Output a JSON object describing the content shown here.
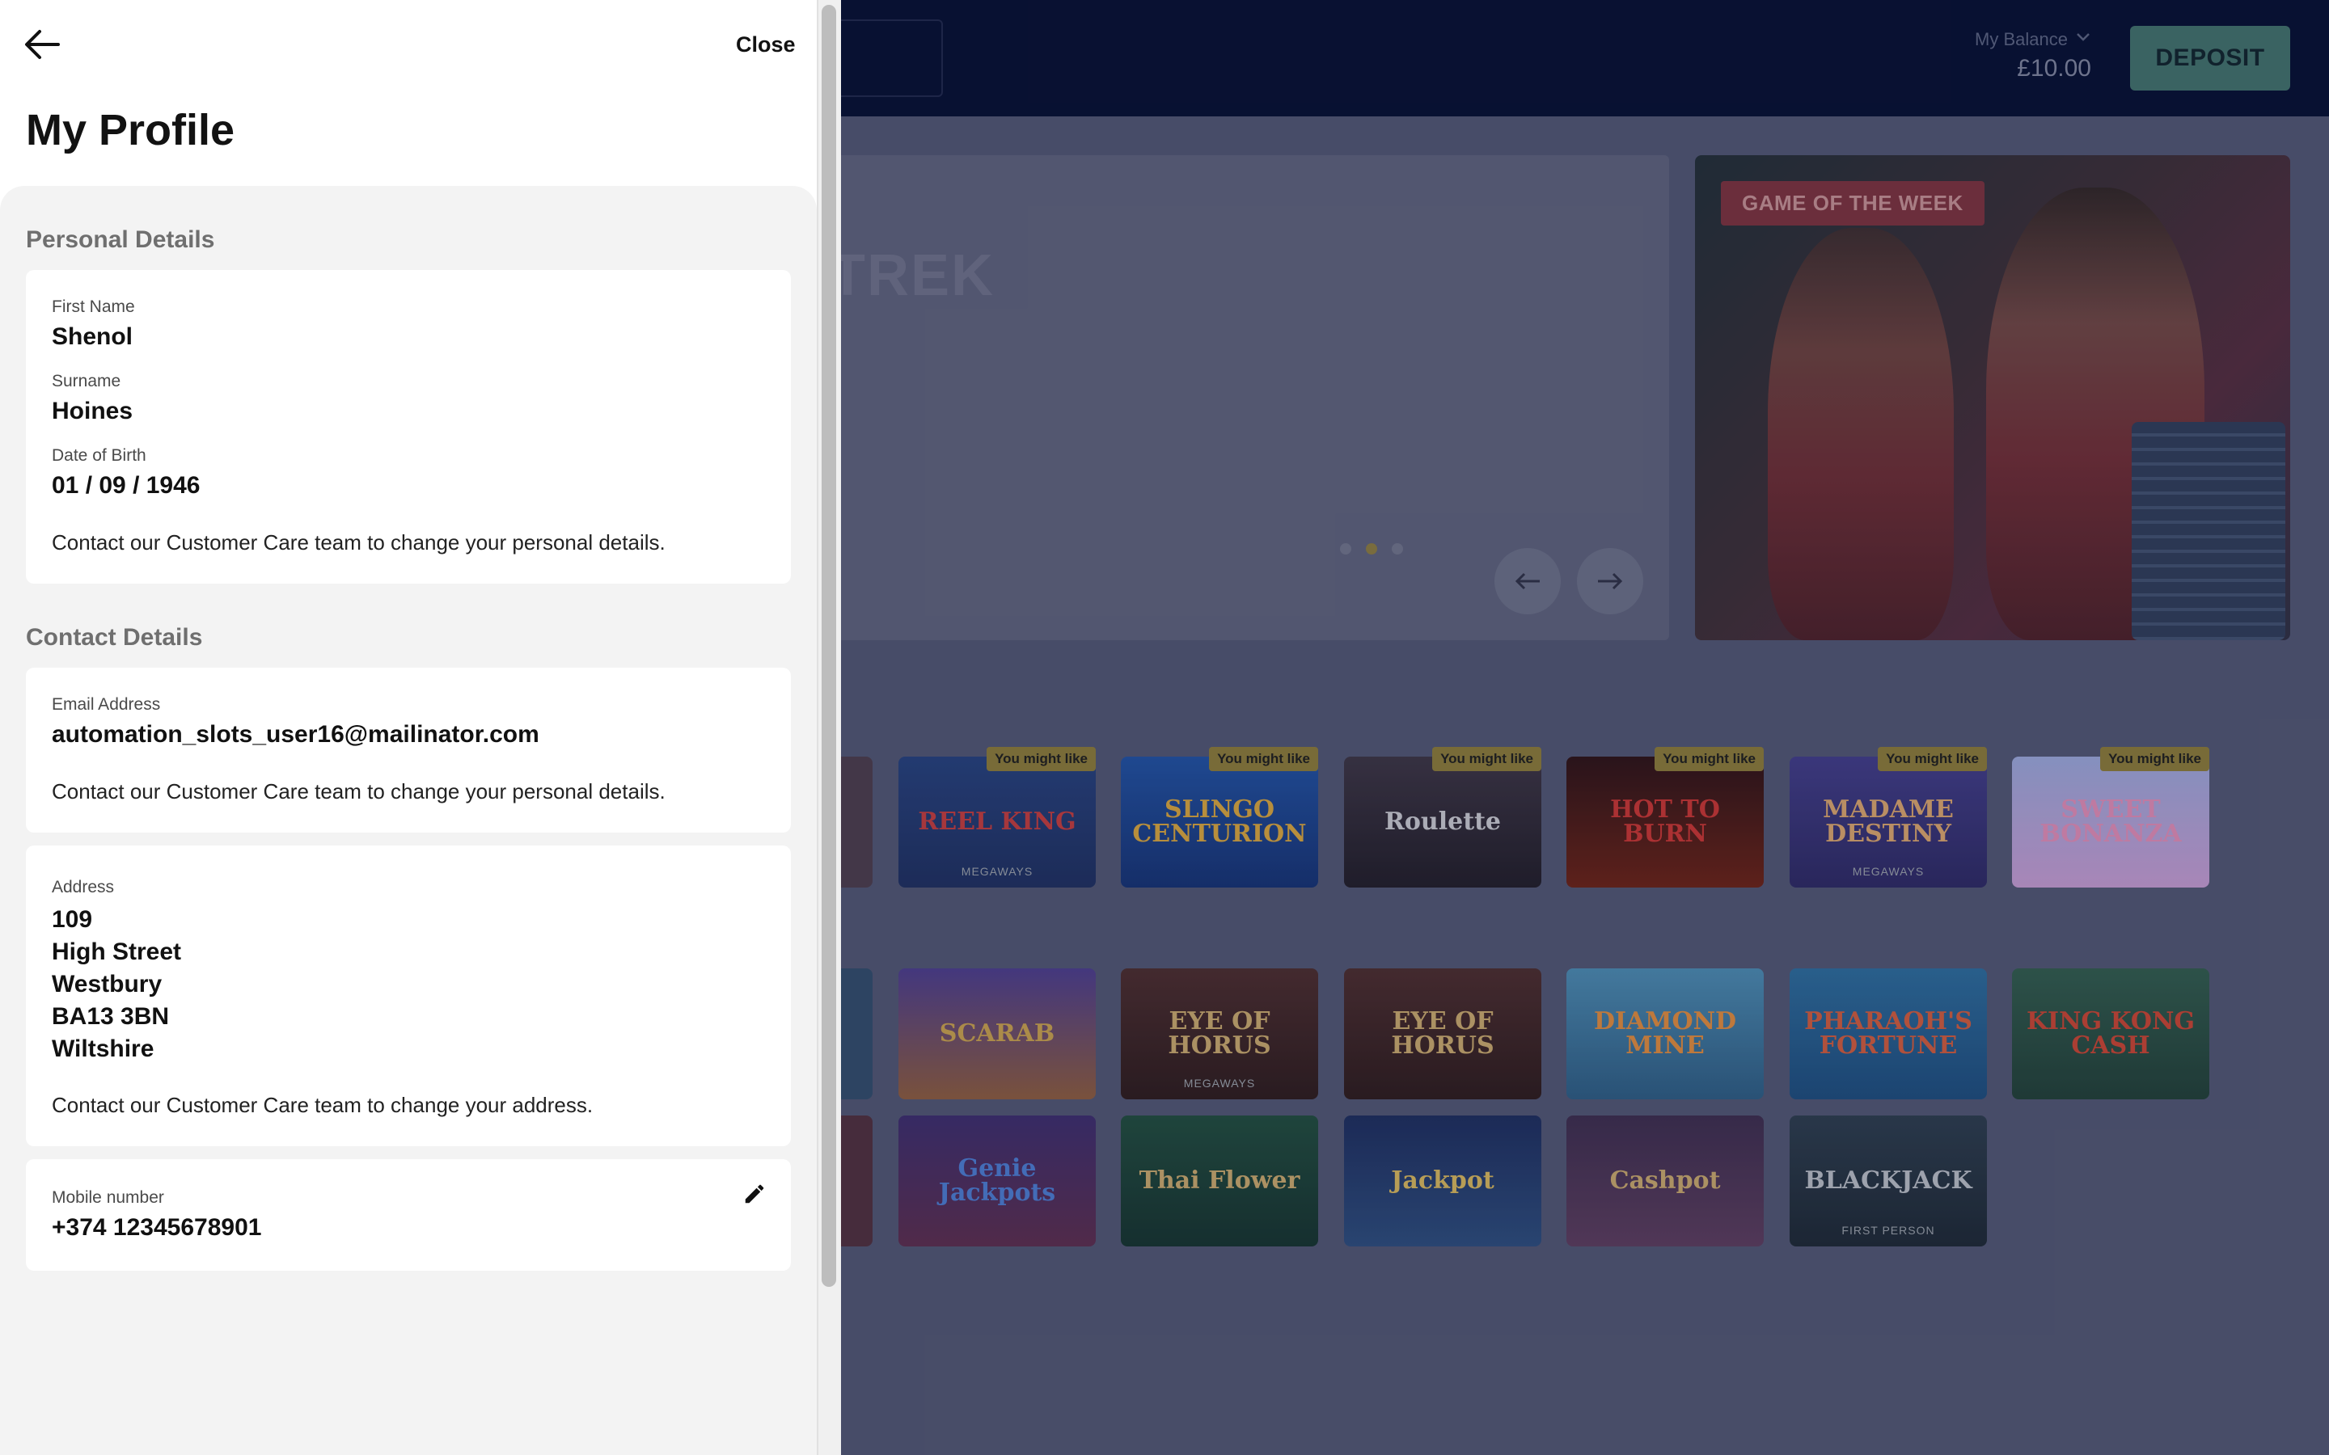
{
  "header": {
    "balance_label": "My Balance",
    "balance_value": "£10.00",
    "deposit_label": "DEPOSIT"
  },
  "hero": {
    "title_fragment": "TREK",
    "game_of_week_badge": "GAME OF THE WEEK"
  },
  "games": {
    "badge": "You might like",
    "row1": [
      "REEL KING",
      "SLINGO CENTURION",
      "Roulette",
      "HOT TO BURN",
      "MADAME DESTINY",
      "SWEET BONANZA"
    ],
    "row1_subs": [
      "MEGAWAYS",
      "",
      "",
      "",
      "MEGAWAYS",
      ""
    ],
    "row2": [
      "SCARAB",
      "EYE OF HORUS",
      "EYE OF HORUS",
      "DIAMOND MINE",
      "PHARAOH'S FORTUNE",
      "KING KONG CASH"
    ],
    "row2_subs": [
      "",
      "MEGAWAYS",
      "",
      "",
      "",
      ""
    ],
    "row3": [
      "Genie Jackpots",
      "Thai Flower",
      "Jackpot",
      "Cashpot",
      "BLACKJACK"
    ],
    "row3_subs": [
      "",
      "",
      "",
      "",
      "FIRST PERSON"
    ]
  },
  "drawer": {
    "close_label": "Close",
    "title": "My Profile",
    "personal_section": "Personal Details",
    "first_name_label": "First Name",
    "first_name": "Shenol",
    "surname_label": "Surname",
    "surname": "Hoines",
    "dob_label": "Date of Birth",
    "dob": "01 / 09 / 1946",
    "personal_note": "Contact our Customer Care team to change your personal details.",
    "contact_section": "Contact Details",
    "email_label": "Email Address",
    "email": "automation_slots_user16@mailinator.com",
    "email_note": "Contact our Customer Care team to change your personal details.",
    "address_label": "Address",
    "address_lines": [
      "109",
      "High Street",
      "Westbury",
      "BA13 3BN",
      "Wiltshire"
    ],
    "address_note": "Contact our Customer Care team to change your address.",
    "mobile_label": "Mobile number",
    "mobile": "+374 12345678901"
  },
  "icons": {
    "back": "arrow-left-icon",
    "edit": "pencil-icon",
    "carousel_prev": "arrow-left-icon",
    "carousel_next": "arrow-right-icon",
    "balance_toggle": "chevron-down-icon"
  },
  "colors": {
    "topbar": "#020b2e",
    "deposit": "#3f6f68",
    "badge_gold": "#8a7935",
    "drawer_bg": "#ffffff",
    "drawer_content": "#f3f3f3"
  }
}
